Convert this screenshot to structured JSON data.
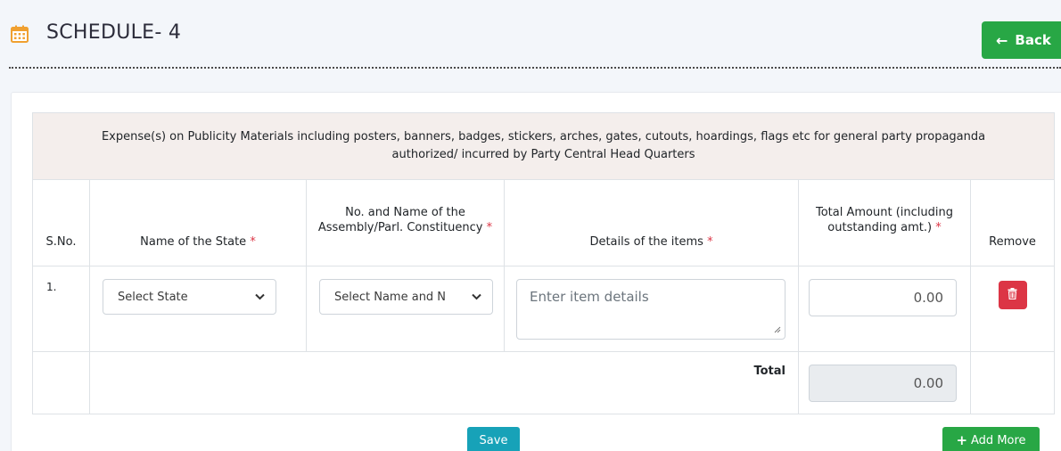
{
  "header": {
    "title": "SCHEDULE- 4",
    "back_label": "Back",
    "back_arrow": "←"
  },
  "table": {
    "caption": "Expense(s) on Publicity Materials including posters, banners, badges, stickers, arches, gates, cutouts, hoardings, flags etc for general party propaganda authorized/ incurred by Party Central Head Quarters",
    "columns": {
      "sno": "S.No.",
      "state": "Name of the State",
      "constituency": "No. and Name of the Assembly/Parl. Constituency",
      "details": "Details of the items",
      "amount": "Total Amount (including outstanding amt.)",
      "remove": "Remove"
    },
    "required_mark": "*",
    "rows": [
      {
        "sno": "1.",
        "state_value": "Select State",
        "constituency_value": "Select Name and N",
        "details_placeholder": "Enter item details",
        "amount_value": "0.00"
      }
    ],
    "total_label": "Total",
    "total_value": "0.00"
  },
  "actions": {
    "save_label": "Save",
    "add_more_label": "Add More",
    "add_more_icon": "+"
  },
  "icons": [
    "calendar-icon",
    "arrow-left-icon",
    "chevron-down-icon",
    "trash-icon",
    "plus-icon",
    "resize-grip-icon"
  ],
  "colors": {
    "back_button": "#28a745",
    "delete_button": "#dc3545",
    "save_button": "#17a2b8",
    "add_more_button": "#28a745",
    "required": "#dc3545",
    "caption_bg": "#f4eeec",
    "calendar_icon": "#f0a030"
  }
}
